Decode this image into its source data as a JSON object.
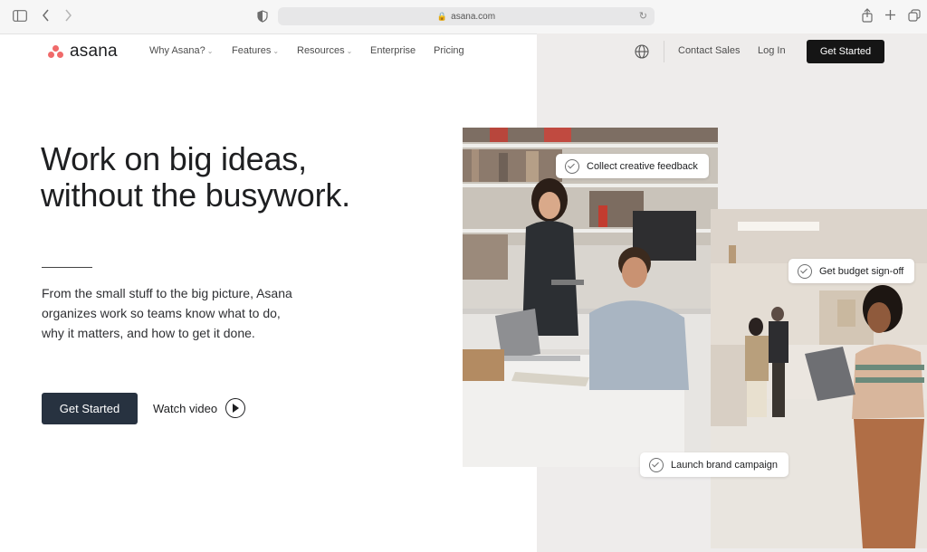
{
  "browser": {
    "url": "asana.com",
    "colors": {
      "toolbar": "#f6f6f6",
      "address_bar": "#e7e7e8"
    }
  },
  "nav": {
    "logo_text": "asana",
    "items": [
      {
        "label": "Why Asana?",
        "has_dropdown": true
      },
      {
        "label": "Features",
        "has_dropdown": true
      },
      {
        "label": "Resources",
        "has_dropdown": true
      },
      {
        "label": "Enterprise",
        "has_dropdown": false
      },
      {
        "label": "Pricing",
        "has_dropdown": false
      }
    ],
    "language_icon": "globe-icon",
    "contact_sales": "Contact Sales",
    "log_in": "Log In",
    "get_started": "Get Started"
  },
  "hero": {
    "headline_line1": "Work on big ideas,",
    "headline_line2": "without the busywork.",
    "sub_line1": "From the small stuff to the big picture, Asana",
    "sub_line2": "organizes work so teams know what to do,",
    "sub_line3": "why it matters, and how to get it done.",
    "cta_label": "Get Started",
    "watch_label": "Watch video"
  },
  "tasks": [
    {
      "label": "Collect creative feedback"
    },
    {
      "label": "Get budget sign-off"
    },
    {
      "label": "Launch brand campaign"
    }
  ],
  "colors": {
    "brand_coral": "#f06a6a",
    "hero_button": "#273240",
    "top_button": "#151515",
    "panel_bg": "#eeeceb",
    "text": "#1e1f21"
  }
}
